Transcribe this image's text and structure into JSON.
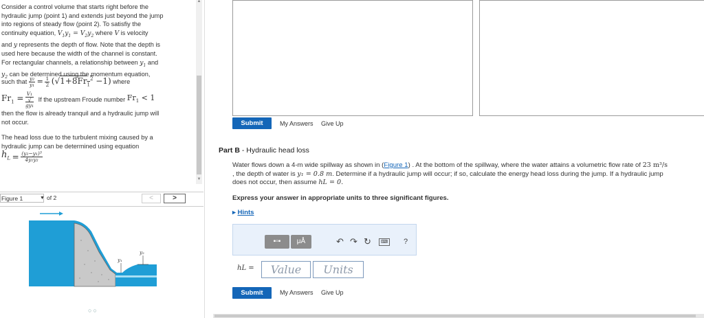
{
  "problem": {
    "p1_lines": [
      "Consider a control volume that starts right before the",
      "hydraulic jump (point 1) and extends just beyond the jump",
      "into regions of steady flow (point 2). To satisfiy the",
      "continuity equation,",
      "where",
      "is velocity",
      "and",
      "represents the depth of flow. Note that the depth is",
      "used here because the width of the channel is constant.",
      "For rectangular channels, a relationship between",
      "and",
      "can be determined using the momentum equation,"
    ],
    "such_that": "such that",
    "where": "where",
    "froude_cond": "If the upstream Froude number",
    "then_line1": "then the flow is already tranquil and a hydraulic jump will",
    "then_line2": "not occur.",
    "head_loss_lines": [
      "The head loss due to the turbulent mixing caused by a",
      "hydraulic jump can be determined using equation"
    ]
  },
  "figure_nav": {
    "select_value": "Figure 1",
    "of_text": "of 2",
    "prev": "<",
    "next": ">",
    "label_y1": "y₁",
    "label_y2": "y₂"
  },
  "part_a": {
    "submit": "Submit",
    "my_answers": "My Answers",
    "give_up": "Give Up"
  },
  "part_b": {
    "title_bold": "Part B",
    "title_rest": " - Hydraulic head loss",
    "body_1": "Water flows down a 4-m wide spillway as shown in (",
    "figure_link": "Figure 1",
    "body_2": ") . At the bottom of the spillway, where the water attains a volumetric flow rate of",
    "flow_rate": "23 m³/s",
    "body_3": ", the depth of water is",
    "depth": "y₁ = 0.8 m",
    "body_4": ". Determine if a hydraulic jump will occur; if so, calculate the energy head loss during the jump. If a hydraulic jump",
    "body_5": "does not occur, then assume",
    "assume": "hL = 0.",
    "express": "Express your answer in appropriate units to three significant figures.",
    "hints": "Hints",
    "answer_label": "hL =",
    "value_placeholder": "Value",
    "units_placeholder": "Units",
    "toolbar": {
      "mu": "μÅ",
      "help": "?"
    },
    "submit": "Submit",
    "my_answers": "My Answers",
    "give_up": "Give Up"
  },
  "colors": {
    "accent": "#1466b8",
    "water": "#1f9ed6"
  }
}
